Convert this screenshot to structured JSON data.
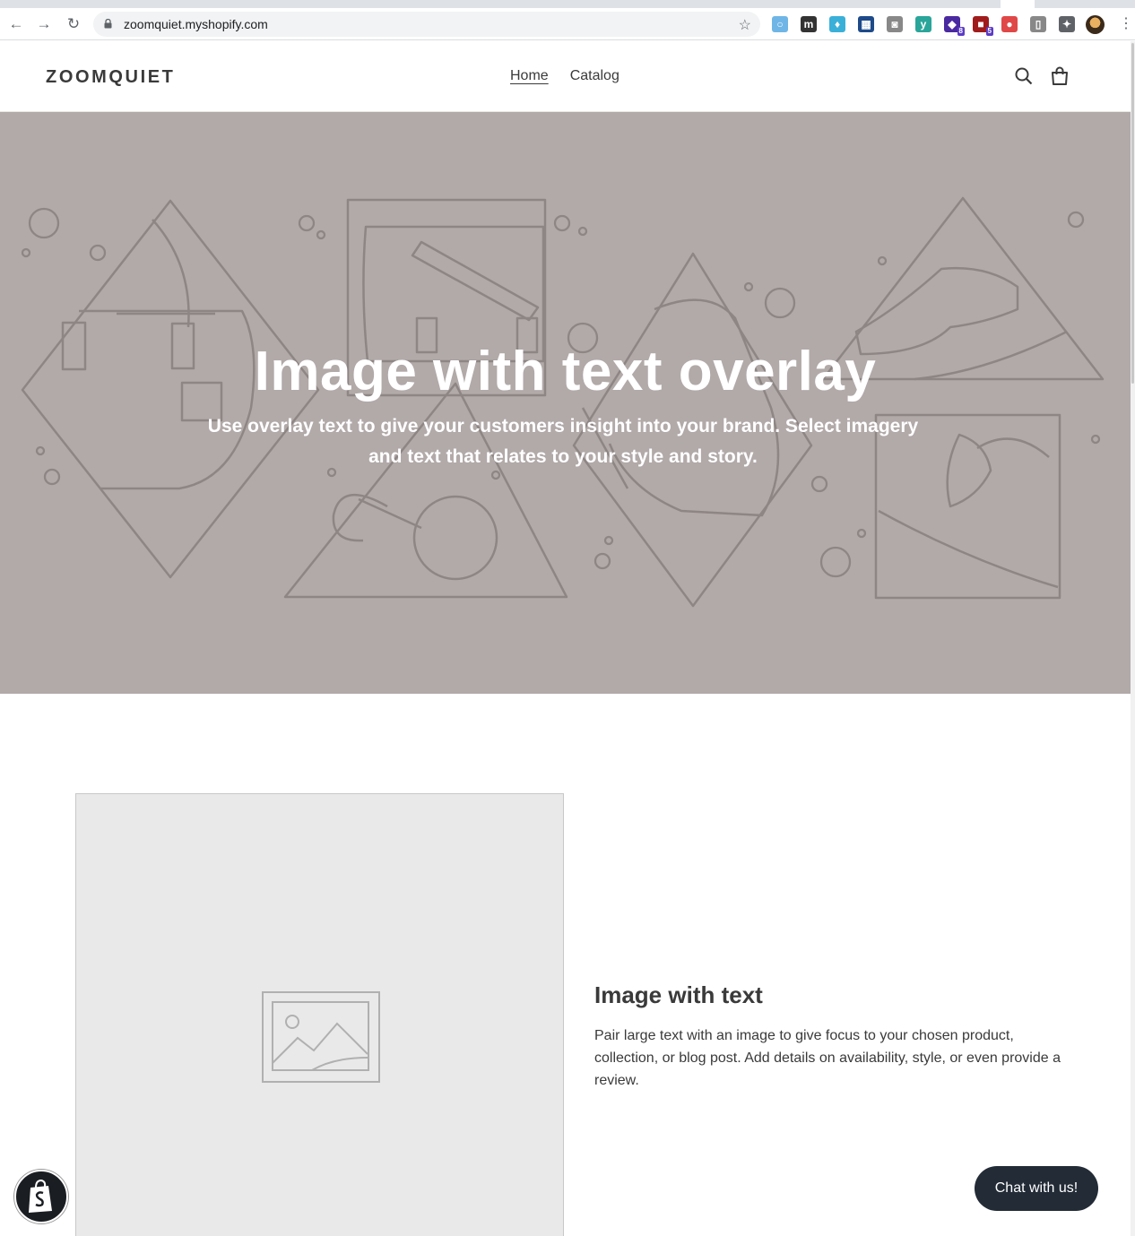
{
  "browser": {
    "url": "zoomquiet.myshopify.com",
    "extensions": [
      {
        "name": "ring-extension-icon",
        "color": "#6fb6e6"
      },
      {
        "name": "m-extension-icon",
        "color": "#333333"
      },
      {
        "name": "shirt-extension-icon",
        "color": "#3ab0d8"
      },
      {
        "name": "grid-extension-icon",
        "color": "#1e4a8a"
      },
      {
        "name": "camera-extension-icon",
        "color": "#888888"
      },
      {
        "name": "y-extension-icon",
        "color": "#2aa59a"
      },
      {
        "name": "cap-extension-icon",
        "color": "#4a2aa0",
        "badge": "8"
      },
      {
        "name": "shield-extension-icon",
        "color": "#a01c1c",
        "badge": "5"
      },
      {
        "name": "dice-extension-icon",
        "color": "#e04848"
      },
      {
        "name": "book-extension-icon",
        "color": "#888888"
      },
      {
        "name": "puzzle-extension-icon",
        "color": "#5f6368"
      }
    ]
  },
  "header": {
    "logo": "ZOOMQUIET",
    "nav": [
      {
        "label": "Home",
        "active": true
      },
      {
        "label": "Catalog",
        "active": false
      }
    ]
  },
  "hero": {
    "title": "Image with text overlay",
    "subtitle": "Use overlay text to give your customers insight into your brand. Select imagery and text that relates to your style and story.",
    "background": "#b2a9a9"
  },
  "image_with_text": {
    "heading": "Image with text",
    "body": "Pair large text with an image to give focus to your chosen product, collection, or blog post. Add details on availability, style, or even provide a review."
  },
  "chat": {
    "label": "Chat with us!"
  }
}
